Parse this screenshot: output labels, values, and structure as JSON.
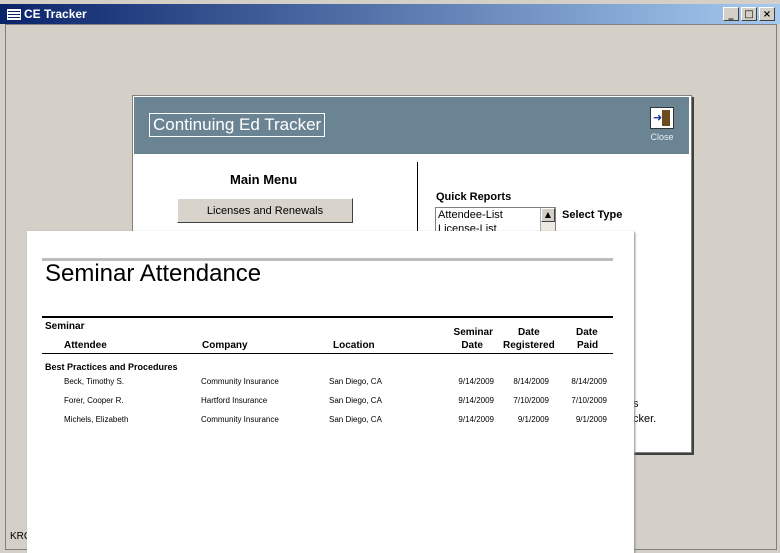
{
  "app": {
    "title": "CE Tracker"
  },
  "window_controls": {
    "minimize": "_",
    "maximize": "□",
    "close": "×"
  },
  "form": {
    "title": "Continuing Ed Tracker",
    "close_label": "Close",
    "main_menu": "Main Menu",
    "licenses_button": "Licenses and Renewals",
    "quick_reports_label": "Quick Reports",
    "quick_reports_items": [
      "Attendee-List",
      "License-List"
    ],
    "select_type": "Select Type",
    "frag1": "s",
    "frag2": "cker."
  },
  "status": {
    "text": "KRC"
  },
  "report": {
    "title": "Seminar Attendance",
    "headers": {
      "seminar": "Seminar",
      "attendee": "Attendee",
      "company": "Company",
      "location": "Location",
      "seminar_date_1": "Seminar",
      "seminar_date_2": "Date",
      "date_registered_1": "Date",
      "date_registered_2": "Registered",
      "date_paid_1": "Date",
      "date_paid_2": "Paid"
    },
    "group": "Best Practices and Procedures",
    "rows": [
      {
        "attendee": "Beck, Timothy S.",
        "company": "Community Insurance",
        "location": "San Diego, CA",
        "seminar_date": "9/14/2009",
        "registered": "8/14/2009",
        "paid": "8/14/2009"
      },
      {
        "attendee": "Forer, Cooper R.",
        "company": "Hartford Insurance",
        "location": "San Diego, CA",
        "seminar_date": "9/14/2009",
        "registered": "7/10/2009",
        "paid": "7/10/2009"
      },
      {
        "attendee": "Michels, Elizabeth",
        "company": "Community Insurance",
        "location": "San Diego, CA",
        "seminar_date": "9/14/2009",
        "registered": "9/1/2009",
        "paid": "9/1/2009"
      }
    ]
  }
}
